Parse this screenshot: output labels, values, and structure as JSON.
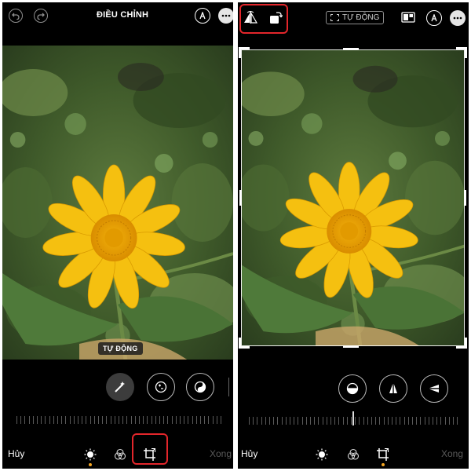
{
  "left": {
    "header": {
      "title": "ĐIỀU CHỈNH"
    },
    "photo_badge": "TỰ ĐỘNG",
    "bottom": {
      "cancel": "Hủy",
      "done": "Xong"
    },
    "icons": {
      "undo": "undo-icon",
      "redo": "redo-icon",
      "markup": "markup-icon",
      "more": "more-icon",
      "auto_enhance": "magic-wand-icon",
      "exposure": "exposure-icon",
      "brilliance": "brilliance-icon",
      "adjust": "adjust-icon",
      "filters": "filters-icon",
      "crop": "crop-icon"
    }
  },
  "right": {
    "header": {
      "auto_label": "TỰ ĐỘNG"
    },
    "bottom": {
      "cancel": "Hủy",
      "done": "Xong"
    },
    "icons": {
      "flip": "flip-icon",
      "rotate": "rotate-icon",
      "auto": "auto-crop-icon",
      "aspect": "aspect-ratio-icon",
      "markup": "markup-icon",
      "more": "more-icon",
      "straighten": "straighten-icon",
      "vertical": "vertical-perspective-icon",
      "horizontal": "horizontal-perspective-icon",
      "adjust": "adjust-icon",
      "filters": "filters-icon",
      "crop": "crop-icon"
    }
  },
  "colors": {
    "highlight": "#e3262b",
    "active_dot": "#f5a623",
    "done_disabled": "#5a5a5a"
  }
}
